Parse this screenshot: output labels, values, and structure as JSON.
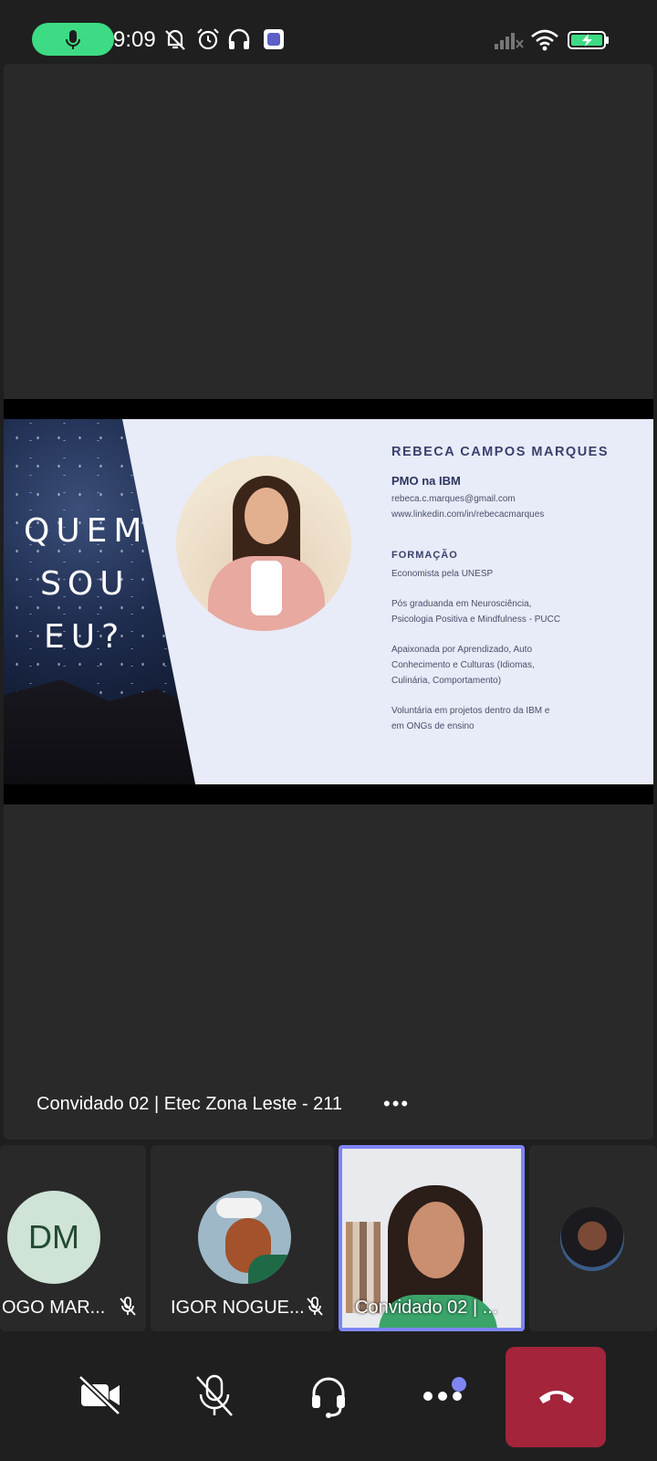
{
  "status_bar": {
    "time": "9:09",
    "icons": [
      "mic-active-icon",
      "mute-bell-icon",
      "alarm-icon",
      "headphones-icon",
      "teams-icon",
      "signal-icon",
      "wifi-icon",
      "battery-charging-icon"
    ],
    "mic_pill_color": "#3ddc84"
  },
  "shared_slide": {
    "left_text": [
      "QUEM",
      "SOU",
      "EU?"
    ],
    "name": "REBECA CAMPOS MARQUES",
    "role": "PMO na IBM",
    "email": "rebeca.c.marques@gmail.com",
    "linkedin": "www.linkedin.com/in/rebecacmarques",
    "section_heading": "FORMAÇÃO",
    "items": [
      "Economista pela UNESP",
      "Pós graduanda em Neurosciência,",
      "Psicologia Positiva e Mindfulness - PUCC",
      "Apaixonada por Aprendizado, Auto",
      "Conhecimento e Culturas (Idiomas,",
      "Culinária, Comportamento)",
      "Voluntária em projetos dentro da IBM e",
      "em ONGs de ensino"
    ]
  },
  "presenter": {
    "label": "Convidado 02 | Etec Zona Leste - 211",
    "more": "•••"
  },
  "participants": [
    {
      "initials": "DM",
      "name": "OGO MAR...",
      "muted": true
    },
    {
      "name": "IGOR NOGUE...",
      "muted": true
    },
    {
      "name": "Convidado 02 | ...",
      "active_speaker": true
    },
    {
      "name": ""
    }
  ],
  "controls": {
    "camera": "camera-off-icon",
    "mic": "mic-off-icon",
    "audio": "headset-icon",
    "more": "more-icon",
    "hangup": "hang-up-icon",
    "accent": "#7f85f5",
    "hangup_color": "#a4243b"
  }
}
